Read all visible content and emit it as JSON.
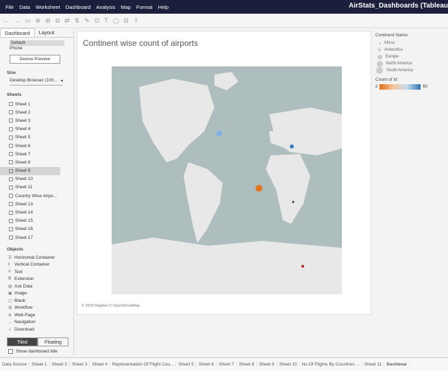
{
  "menu": [
    "File",
    "Data",
    "Worksheet",
    "Dashboard",
    "Analysis",
    "Map",
    "Format",
    "Help"
  ],
  "app_title": "AirStats_Dashboards (Tableau",
  "left_panel": {
    "tabs": [
      "Dashboard",
      "Layout"
    ],
    "devices": [
      "Default",
      "Phone"
    ],
    "device_preview_label": "Device Preview",
    "size_heading": "Size",
    "size_value": "Desktop Browser (100...",
    "sheets_heading": "Sheets",
    "sheets": [
      "Sheet 1",
      "Sheet 2",
      "Sheet 3",
      "Sheet 4",
      "Sheet 5",
      "Sheet 6",
      "Sheet 7",
      "Sheet 8",
      "Sheet 9",
      "Sheet 10",
      "Sheet 11",
      "Country Wise Airpo...",
      "Sheet 13",
      "Sheet 14",
      "Sheet 15",
      "Sheet 16",
      "Sheet 17"
    ],
    "objects_heading": "Objects",
    "objects": [
      "Horizontal Container",
      "Vertical Container",
      "Text",
      "Extension",
      "Ask Data",
      "Image",
      "Blank",
      "Workflow",
      "Web Page",
      "Navigation",
      "Download"
    ],
    "tiled_label": "Tiled",
    "floating_label": "Floating",
    "show_title_label": "Show dashboard title"
  },
  "canvas": {
    "title": "Continent wise count of airports",
    "attribution": "© 2023 Mapbox © OpenStreetMap"
  },
  "legend": {
    "continent_heading": "Continent Name",
    "continents": [
      "Africa",
      "Antarctica",
      "Europe",
      "North America",
      "South America"
    ],
    "count_heading": "Count of Id",
    "count_min": "2",
    "count_max": "60"
  },
  "colors": {
    "low": "#e06c14",
    "high": "#2f74b5",
    "menubar": "#1b1f3b"
  },
  "bottom_tabs": [
    "Data Source",
    "Sheet 1",
    "Sheet 2",
    "Sheet 3",
    "Sheet 4",
    "Representation Of Flight Cou...",
    "Sheet 5",
    "Sheet 6",
    "Sheet 7",
    "Sheet 8",
    "Sheet 9",
    "Sheet 10",
    "No Of Flights By Countries ...",
    "Sheet 11",
    "Dashboar"
  ]
}
